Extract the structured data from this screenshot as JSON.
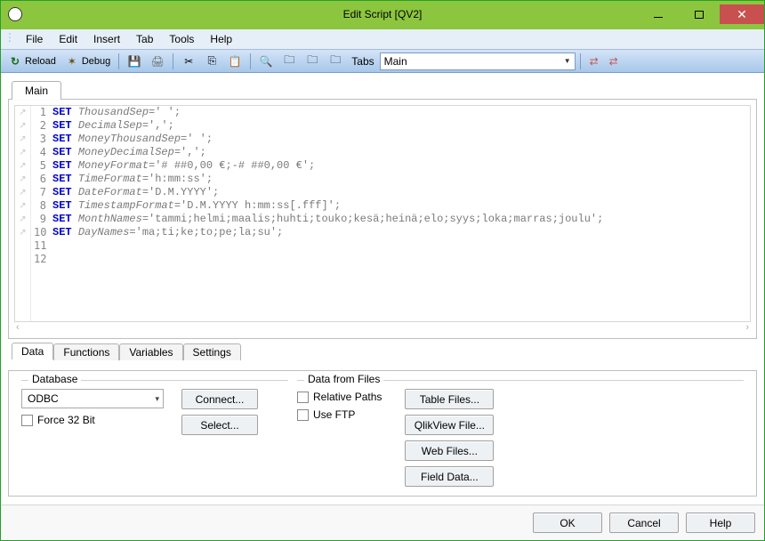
{
  "window": {
    "title": "Edit Script [QV2]"
  },
  "menus": {
    "file": "File",
    "edit": "Edit",
    "insert": "Insert",
    "tab": "Tab",
    "tools": "Tools",
    "help": "Help"
  },
  "toolbar": {
    "reload": "Reload",
    "debug": "Debug",
    "tabs_label": "Tabs",
    "tabs_value": "Main"
  },
  "script_tabs": {
    "main": "Main"
  },
  "code": {
    "lines": [
      {
        "n": 1,
        "kw": "SET",
        "ident": "ThousandSep",
        "rest": "=' ';"
      },
      {
        "n": 2,
        "kw": "SET",
        "ident": "DecimalSep",
        "rest": "=',';"
      },
      {
        "n": 3,
        "kw": "SET",
        "ident": "MoneyThousandSep",
        "rest": "=' ';"
      },
      {
        "n": 4,
        "kw": "SET",
        "ident": "MoneyDecimalSep",
        "rest": "=',';"
      },
      {
        "n": 5,
        "kw": "SET",
        "ident": "MoneyFormat",
        "rest": "='# ##0,00 €;-# ##0,00 €';"
      },
      {
        "n": 6,
        "kw": "SET",
        "ident": "TimeFormat",
        "rest": "='h:mm:ss';"
      },
      {
        "n": 7,
        "kw": "SET",
        "ident": "DateFormat",
        "rest": "='D.M.YYYY';"
      },
      {
        "n": 8,
        "kw": "SET",
        "ident": "TimestampFormat",
        "rest": "='D.M.YYYY h:mm:ss[.fff]';"
      },
      {
        "n": 9,
        "kw": "SET",
        "ident": "MonthNames",
        "rest": "='tammi;helmi;maalis;huhti;touko;kesä;heinä;elo;syys;loka;marras;joulu';"
      },
      {
        "n": 10,
        "kw": "SET",
        "ident": "DayNames",
        "rest": "='ma;ti;ke;to;pe;la;su';"
      },
      {
        "n": 11,
        "kw": "",
        "ident": "",
        "rest": ""
      },
      {
        "n": 12,
        "kw": "",
        "ident": "",
        "rest": ""
      }
    ]
  },
  "panel_tabs": {
    "data": "Data",
    "functions": "Functions",
    "variables": "Variables",
    "settings": "Settings"
  },
  "database": {
    "legend": "Database",
    "driver": "ODBC",
    "connect": "Connect...",
    "select": "Select...",
    "force32": "Force 32 Bit"
  },
  "datafiles": {
    "legend": "Data from Files",
    "relative": "Relative Paths",
    "useftp": "Use FTP",
    "tablefiles": "Table Files...",
    "qvfile": "QlikView File...",
    "webfiles": "Web Files...",
    "fielddata": "Field Data..."
  },
  "footer": {
    "ok": "OK",
    "cancel": "Cancel",
    "help": "Help"
  }
}
